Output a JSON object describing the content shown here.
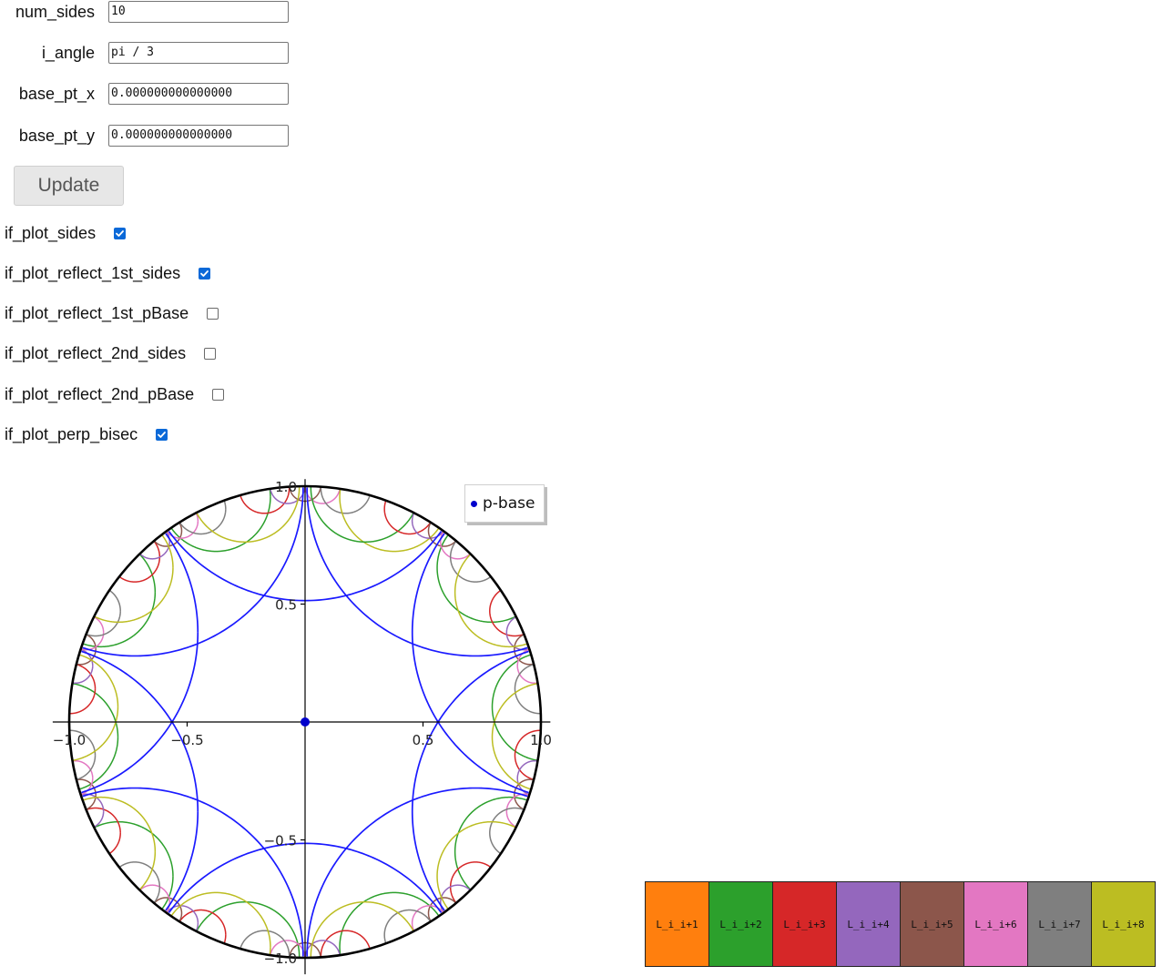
{
  "form": {
    "fields": [
      {
        "label": "num_sides",
        "value": "10"
      },
      {
        "label": "i_angle",
        "value": "pi / 3"
      },
      {
        "label": "base_pt_x",
        "value": "0.000000000000000"
      },
      {
        "label": "base_pt_y",
        "value": "0.000000000000000"
      }
    ],
    "update_label": "Update"
  },
  "checkboxes": [
    {
      "label": "if_plot_sides",
      "checked": true
    },
    {
      "label": "if_plot_reflect_1st_sides",
      "checked": true
    },
    {
      "label": "if_plot_reflect_1st_pBase",
      "checked": false
    },
    {
      "label": "if_plot_reflect_2nd_sides",
      "checked": false
    },
    {
      "label": "if_plot_reflect_2nd_pBase",
      "checked": false
    },
    {
      "label": "if_plot_perp_bisec",
      "checked": true
    }
  ],
  "plot": {
    "legend_label": "p-base",
    "x_ticks": [
      "−1.0",
      "−0.5",
      "0.5",
      "1.0"
    ],
    "y_ticks": [
      "1.0",
      "0.5",
      "−0.5",
      "−1.0"
    ],
    "colors": {
      "sides": "#1a1aff",
      "reflect": "#ff7f0e",
      "base_point": "#0000cc",
      "boundary": "#000000"
    }
  },
  "swatches": [
    {
      "label": "L_i_i+1",
      "color": "#ff7f0e"
    },
    {
      "label": "L_i_i+2",
      "color": "#2ca02c"
    },
    {
      "label": "L_i_i+3",
      "color": "#d62728"
    },
    {
      "label": "L_i_i+4",
      "color": "#9467bd"
    },
    {
      "label": "L_i_i+5",
      "color": "#8c564b"
    },
    {
      "label": "L_i_i+6",
      "color": "#e377c2"
    },
    {
      "label": "L_i_i+7",
      "color": "#7f7f7f"
    },
    {
      "label": "L_i_i+8",
      "color": "#bcbd22"
    }
  ]
}
